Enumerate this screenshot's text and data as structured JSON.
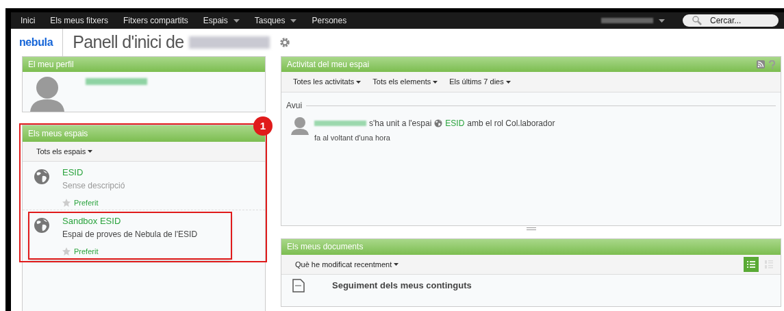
{
  "nav": {
    "items": [
      {
        "label": "Inici",
        "dropdown": false
      },
      {
        "label": "Els meus fitxers",
        "dropdown": false
      },
      {
        "label": "Fitxers compartits",
        "dropdown": false
      },
      {
        "label": "Espais",
        "dropdown": true
      },
      {
        "label": "Tasques",
        "dropdown": true
      },
      {
        "label": "Persones",
        "dropdown": false
      }
    ],
    "search": {
      "placeholder": "Cercar..."
    }
  },
  "header": {
    "logo": "nebula",
    "title": "Panell d'inici de"
  },
  "profile": {
    "title": "El meu perfil"
  },
  "spaces": {
    "title": "Els meus espais",
    "badge": "1",
    "filter": "Tots els espais",
    "items": [
      {
        "name": "ESID",
        "description": "Sense descripció",
        "described": false,
        "favorite": "Preferit",
        "highlighted": false
      },
      {
        "name": "Sandbox ESID",
        "description": "Espai de proves de Nebula de l'ESID",
        "described": true,
        "favorite": "Preferit",
        "highlighted": true
      }
    ]
  },
  "activity": {
    "title": "Activitat del meu espai",
    "filters": [
      "Totes les activitats",
      "Tots els elements",
      "Els últims 7 dies"
    ],
    "day": "Avui",
    "entries": [
      {
        "before": "s'ha unit a l'espai",
        "space": "ESID",
        "after": "amb el rol Col.laborador",
        "time": "fa al voltant d'una hora"
      }
    ]
  },
  "documents": {
    "title": "Els meus documents",
    "filter": "Què he modificat recentment",
    "views": [
      {
        "kind": "list",
        "selected": true
      },
      {
        "kind": "detail",
        "selected": false
      }
    ],
    "rows": [
      "Seguiment dels meus continguts"
    ]
  }
}
